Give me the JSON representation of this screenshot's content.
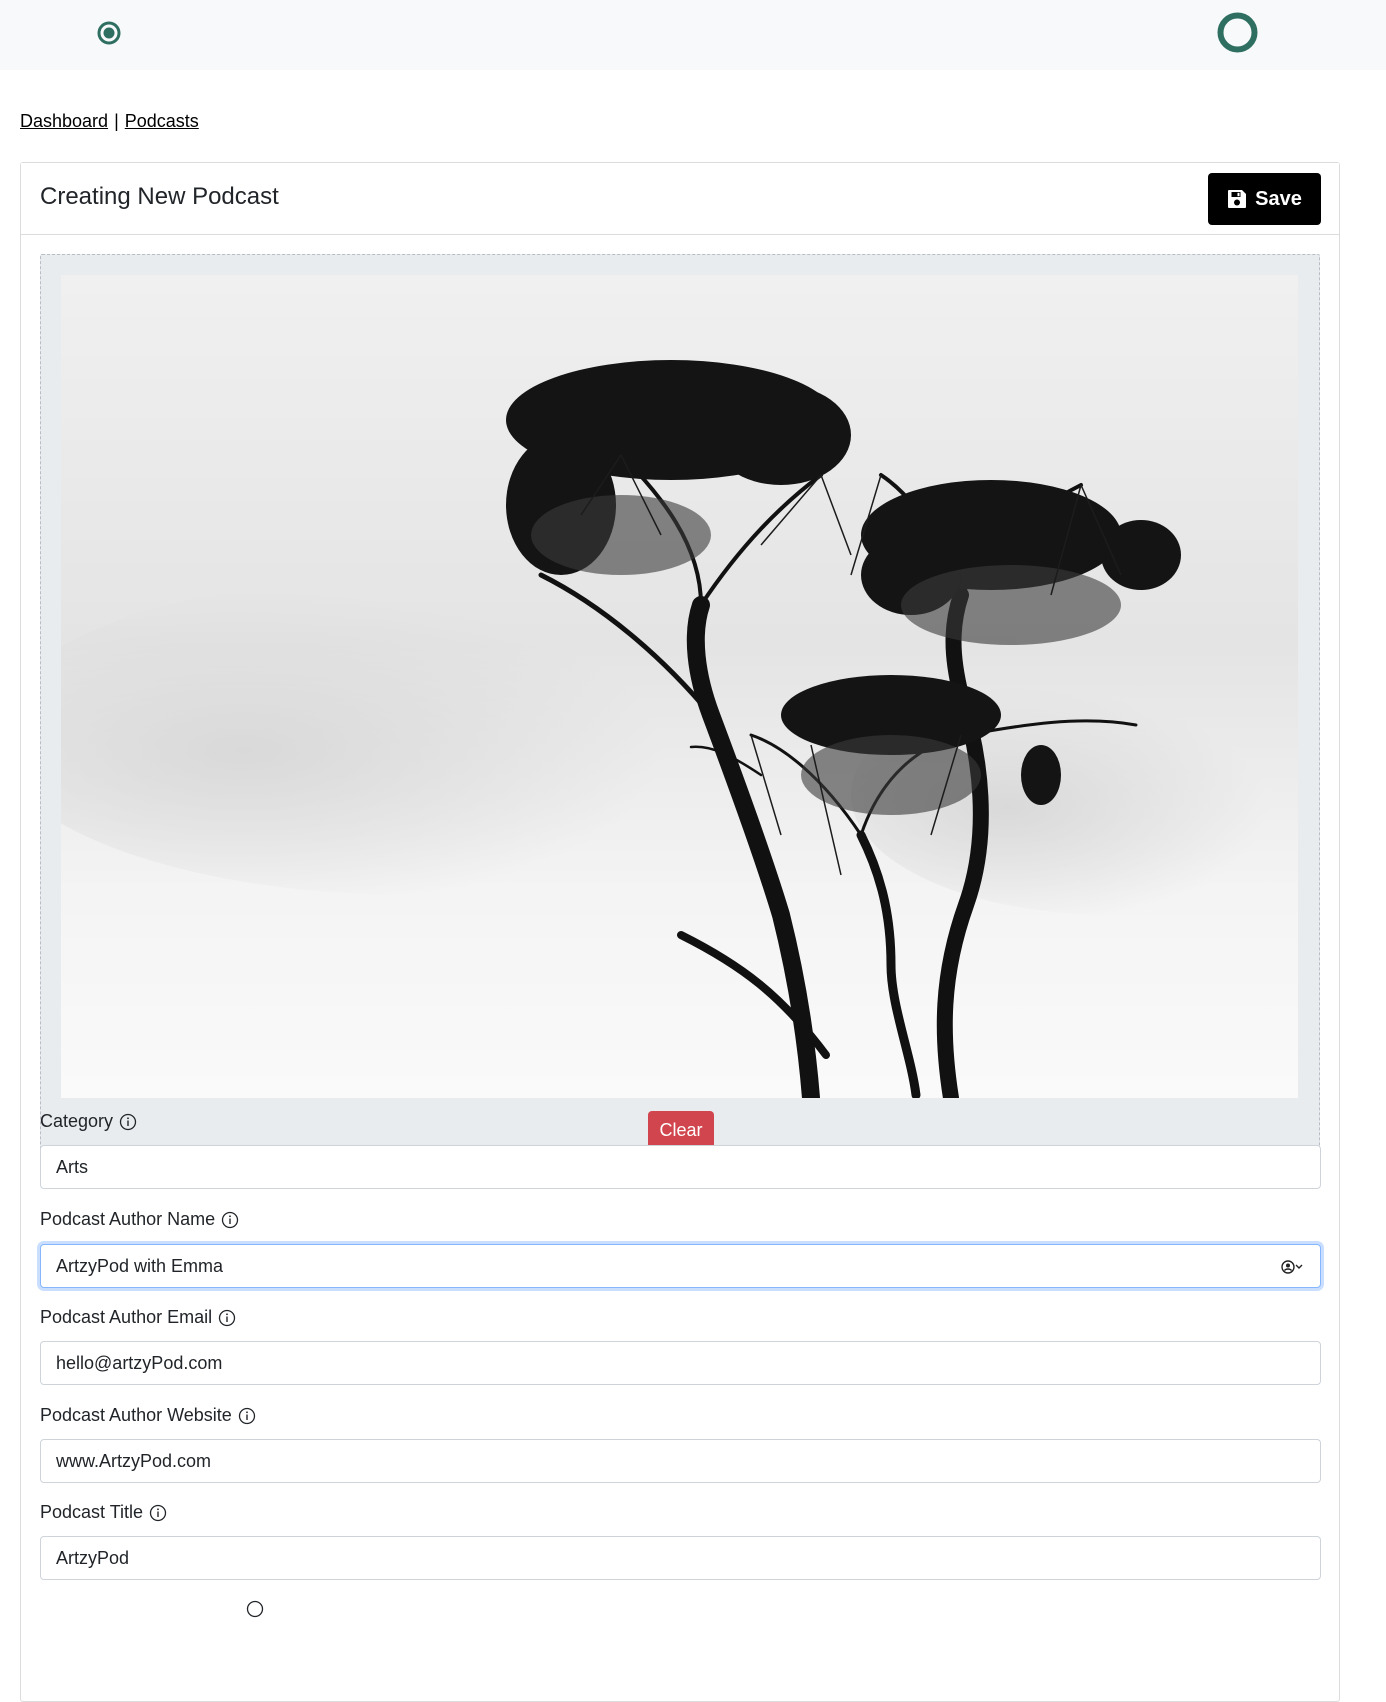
{
  "topbar": {
    "left_icon": "radio-dot-icon",
    "right_icon": "ring-icon",
    "accent_color": "#2f6f62"
  },
  "breadcrumb": {
    "items": [
      {
        "label": "Dashboard"
      },
      {
        "label": "Podcasts"
      }
    ],
    "separator": "|"
  },
  "card": {
    "title": "Creating New Podcast",
    "save_label": "Save",
    "save_icon": "floppy-disk-icon"
  },
  "image_upload": {
    "clear_label": "Clear",
    "clear_color": "#d1454f"
  },
  "form": {
    "category": {
      "label": "Category",
      "value": "Arts"
    },
    "author_name": {
      "label": "Podcast Author Name",
      "value": "ArtzyPod with Emma"
    },
    "author_email": {
      "label": "Podcast Author Email",
      "value": "hello@artzyPod.com"
    },
    "author_website": {
      "label": "Podcast Author Website",
      "value": "www.ArtzyPod.com"
    },
    "podcast_title": {
      "label": "Podcast Title",
      "value": "ArtzyPod"
    }
  }
}
